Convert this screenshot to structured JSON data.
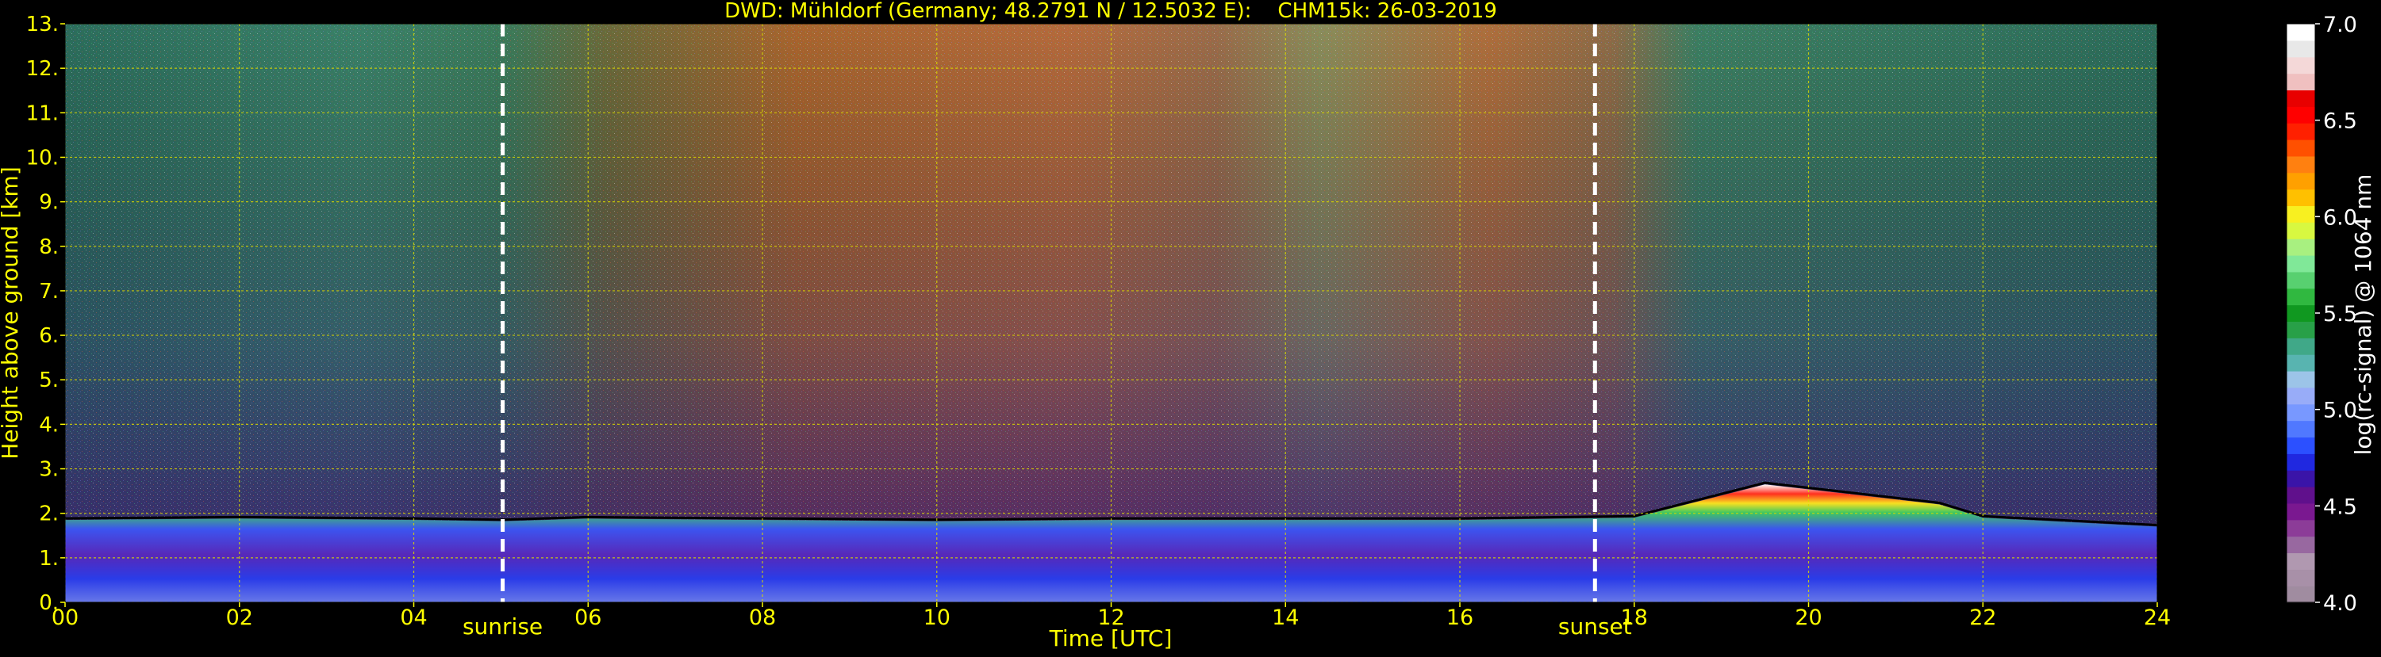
{
  "chart_data": {
    "type": "heatmap",
    "title": "DWD: Mühldorf (Germany; 48.2791 N / 12.5032 E):    CHM15k: 26-03-2019",
    "xlabel": "Time [UTC]",
    "ylabel": "Height above ground [km]",
    "xlim": [
      0,
      24
    ],
    "ylim": [
      0,
      13
    ],
    "x_ticks": [
      0,
      2,
      4,
      6,
      8,
      10,
      12,
      14,
      16,
      18,
      20,
      22,
      24
    ],
    "x_tick_labels": [
      "00",
      "02",
      "04",
      "06",
      "08",
      "10",
      "12",
      "14",
      "16",
      "18",
      "20",
      "22",
      "24"
    ],
    "y_ticks": [
      0,
      1,
      2,
      3,
      4,
      5,
      6,
      7,
      8,
      9,
      10,
      11,
      12,
      13
    ],
    "y_tick_labels": [
      "0.",
      "1.",
      "2.",
      "3.",
      "4.",
      "5.",
      "6.",
      "7.",
      "8.",
      "9.",
      "10.",
      "11.",
      "12.",
      "13."
    ],
    "grid": true,
    "markers": [
      {
        "label": "sunrise",
        "x": 5.02
      },
      {
        "label": "sunset",
        "x": 17.55
      }
    ],
    "colorbar": {
      "label": "log(rc-signal) @ 1064 nm",
      "range": [
        4.0,
        7.0
      ],
      "ticks": [
        4.0,
        4.5,
        5.0,
        5.5,
        6.0,
        6.5,
        7.0
      ],
      "tick_labels": [
        "4.0",
        "4.5",
        "5.0",
        "5.5",
        "6.0",
        "6.5",
        "7.0"
      ],
      "colors": [
        "#a08ca0",
        "#a890a8",
        "#b098b0",
        "#9868a0",
        "#8c3c98",
        "#7a1890",
        "#60108c",
        "#3a14a8",
        "#2028e0",
        "#2c50ff",
        "#5078ff",
        "#7898ff",
        "#98acf8",
        "#9cc4e8",
        "#58b4b0",
        "#40a888",
        "#28a048",
        "#109820",
        "#30b840",
        "#58d070",
        "#80e898",
        "#a8f080",
        "#d8f840",
        "#f8f020",
        "#ffc000",
        "#ffa000",
        "#ff8010",
        "#ff5000",
        "#ff2000",
        "#ff0000",
        "#e80000",
        "#f0c0c0",
        "#f4d8d8",
        "#e8e8e8",
        "#ffffff"
      ]
    },
    "boundary_layer_top": [
      {
        "x": 0.0,
        "y": 1.85
      },
      {
        "x": 2.0,
        "y": 1.88
      },
      {
        "x": 4.0,
        "y": 1.85
      },
      {
        "x": 5.0,
        "y": 1.82
      },
      {
        "x": 6.0,
        "y": 1.88
      },
      {
        "x": 8.0,
        "y": 1.85
      },
      {
        "x": 10.0,
        "y": 1.82
      },
      {
        "x": 12.0,
        "y": 1.85
      },
      {
        "x": 14.0,
        "y": 1.85
      },
      {
        "x": 16.0,
        "y": 1.85
      },
      {
        "x": 18.0,
        "y": 1.9
      },
      {
        "x": 19.5,
        "y": 2.65
      },
      {
        "x": 21.5,
        "y": 2.2
      },
      {
        "x": 22.0,
        "y": 1.9
      },
      {
        "x": 24.0,
        "y": 1.7
      }
    ]
  }
}
